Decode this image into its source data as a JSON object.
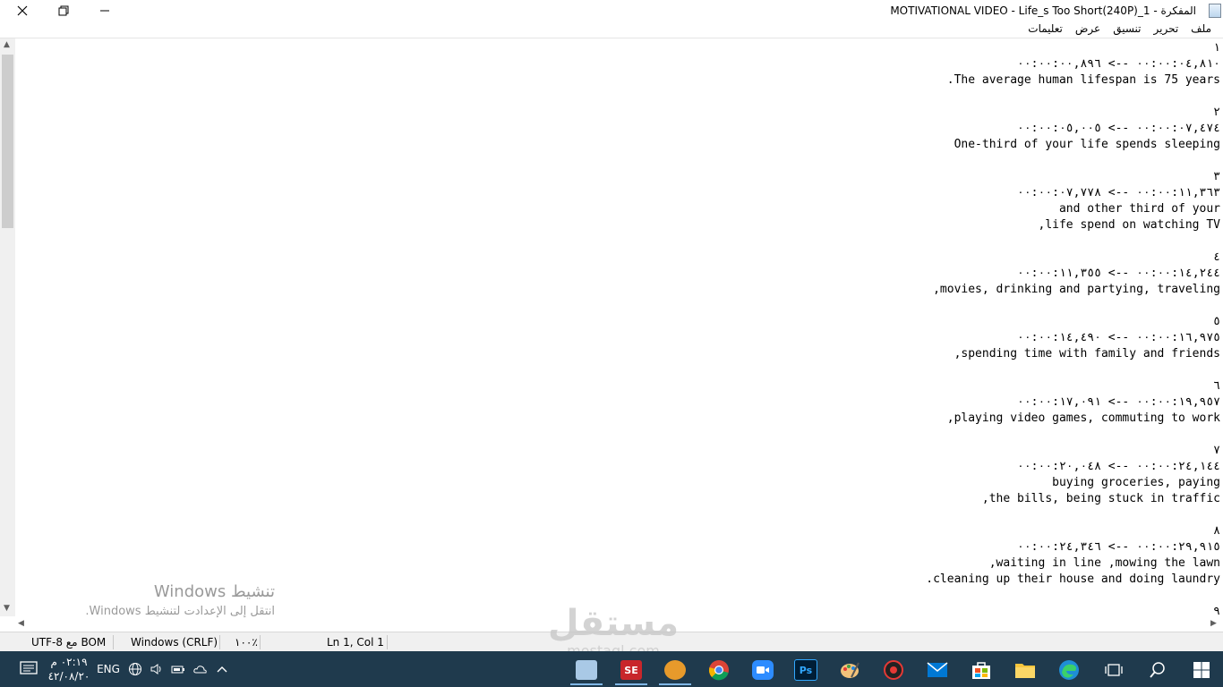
{
  "window": {
    "title": "المفكرة - MOTIVATIONAL VIDEO - Life_s Too Short(240P)_1",
    "icons": {
      "close": "close-icon",
      "restore": "restore-icon",
      "minimize": "minimize-icon",
      "app": "notepad-icon"
    }
  },
  "menu": {
    "file": "ملف",
    "edit": "تحرير",
    "format": "تنسيق",
    "view": "عرض",
    "help": "تعليمات"
  },
  "content": {
    "lines": [
      "١",
      "٠٠:٠٠:٠٤,٨١٠ --> ٠٠:٠٠:٠٠,٨٩٦",
      ".The average human lifespan is 75 years",
      "",
      "٢",
      "٠٠:٠٠:٠٧,٤٧٤ --> ٠٠:٠٠:٠٥,٠٠٥",
      "One-third of your life spends sleeping",
      "",
      "٣",
      "٠٠:٠٠:١١,٣٦٣ --> ٠٠:٠٠:٠٧,٧٧٨",
      "and other third of your",
      ",life spend on watching TV",
      "",
      "٤",
      "٠٠:٠٠:١٤,٢٤٤ --> ٠٠:٠٠:١١,٣٥٥",
      ",movies, drinking and partying, traveling",
      "",
      "٥",
      "٠٠:٠٠:١٦,٩٧٥ --> ٠٠:٠٠:١٤,٤٩٠",
      ",spending time with family and friends",
      "",
      "٦",
      "٠٠:٠٠:١٩,٩٥٧ --> ٠٠:٠٠:١٧,٠٩١",
      ",playing video games, commuting to work",
      "",
      "٧",
      "٠٠:٠٠:٢٤,١٤٤ --> ٠٠:٠٠:٢٠,٠٤٨",
      "buying groceries, paying",
      ",the bills, being stuck in traffic",
      "",
      "٨",
      "٠٠:٠٠:٢٩,٩١٥ --> ٠٠:٠٠:٢٤,٣٤٦",
      ",waiting in line ,mowing the lawn",
      ".cleaning up their house and doing laundry",
      "",
      "٩"
    ]
  },
  "status": {
    "encoding": "UTF-8 مع BOM",
    "line_endings": "Windows (CRLF)",
    "zoom": "١٠٠٪",
    "position": "Ln 1, Col 1"
  },
  "watermark": {
    "activate_title": "تنشيط Windows",
    "activate_sub": "انتقل إلى الإعدادت لتنشيط Windows."
  },
  "mostaql": {
    "arabic": "مستقل",
    "latin": "mostaql.com"
  },
  "taskbar": {
    "time": "٠٢:١٩ م",
    "date": "٤٢/٠٨/٢٠",
    "lang": "ENG",
    "apps": [
      "notepad-icon",
      "subtitle-edit-icon",
      "app-icon",
      "chrome-icon",
      "zoom-icon",
      "photoshop-icon",
      "paint-icon",
      "media-icon",
      "mail-icon",
      "store-icon",
      "file-explorer-icon",
      "edge-icon",
      "task-view-icon",
      "search-icon",
      "start-icon"
    ],
    "ps_label": "Ps",
    "se_label": "SE"
  }
}
